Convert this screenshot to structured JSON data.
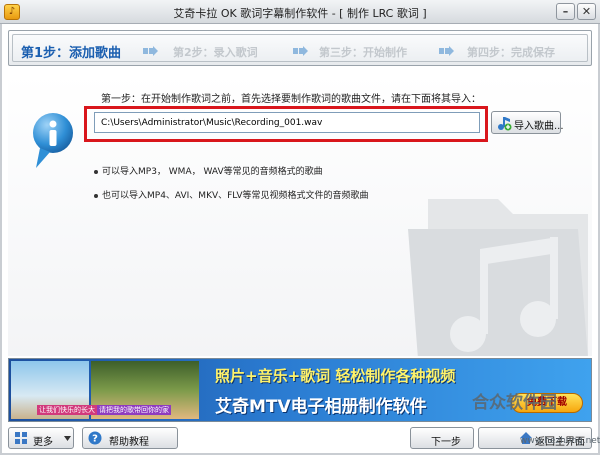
{
  "window": {
    "title": "艾奇卡拉 OK 歌词字幕制作软件 - [ 制作 LRC 歌词 ]",
    "minimize_label": "–",
    "close_label": "✕",
    "app_icon_glyph": "♪"
  },
  "steps": [
    {
      "label": "第1步：添加歌曲",
      "active": true
    },
    {
      "label": "第2步：录入歌词",
      "active": false
    },
    {
      "label": "第三步：开始制作",
      "active": false
    },
    {
      "label": "第四步：完成保存",
      "active": false
    }
  ],
  "content": {
    "hint": "第一步：在开始制作歌词之前，首先选择要制作歌词的歌曲文件，请在下面将其导入：",
    "file_path": "C:\\Users\\Administrator\\Music\\Recording_001.wav",
    "import_button": "导入歌曲...",
    "bullets": [
      "可以导入MP3， WMA， WAV等常见的音频格式的歌曲",
      "也可以导入MP4、AVI、MKV、FLV等常见视频格式文件的音频歌曲"
    ]
  },
  "banner": {
    "caption1": "让我们快乐的长大",
    "caption2": "请把我的歌带回你的家",
    "line1": "照片+音乐+歌词 轻松制作各种视频",
    "line2": "艾奇MTV电子相册制作软件",
    "free_button": "免费下载"
  },
  "bottom": {
    "more_button": "更多",
    "help_button": "帮助教程",
    "next_button": "下一步",
    "home_button": "返回主界面"
  },
  "watermark": {
    "text": "合众软件园",
    "url": "www.hezhong.net"
  },
  "colors": {
    "active_step": "#1b5fb0",
    "highlight_border": "#d9161c",
    "banner_blue": "#2a7ad0"
  }
}
